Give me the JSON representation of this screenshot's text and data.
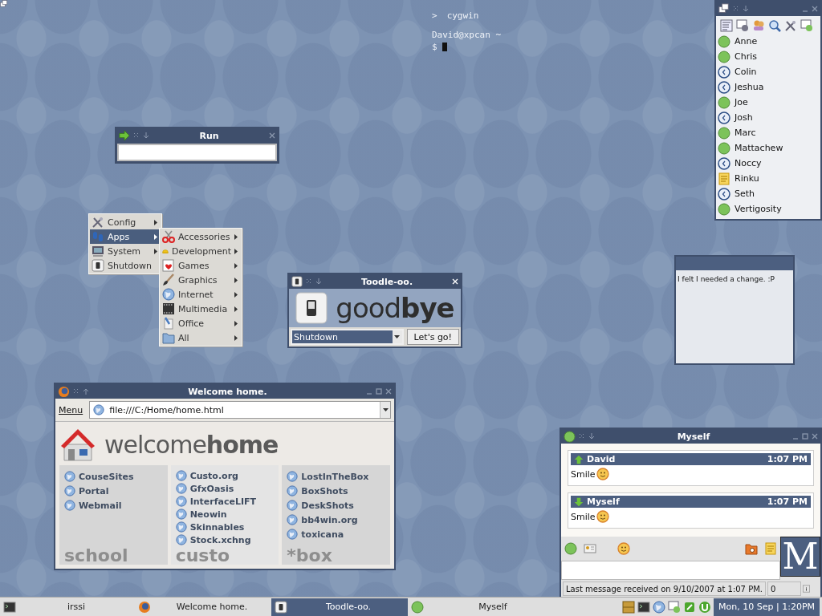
{
  "terminal": {
    "marker": ">",
    "title": "cygwin",
    "lines": [
      "David@xpcan ~",
      "$"
    ]
  },
  "run_window": {
    "title": "Run"
  },
  "start_menu": {
    "items": [
      {
        "label": "Config",
        "submenu": true,
        "selected": false
      },
      {
        "label": "Apps",
        "submenu": true,
        "selected": true
      },
      {
        "label": "System",
        "submenu": true,
        "selected": false
      },
      {
        "label": "Shutdown",
        "submenu": false,
        "selected": false
      }
    ],
    "submenu": {
      "items": [
        {
          "label": "Accessories",
          "submenu": true,
          "selected": false
        },
        {
          "label": "Development",
          "submenu": true,
          "selected": false
        },
        {
          "label": "Games",
          "submenu": true,
          "selected": false
        },
        {
          "label": "Graphics",
          "submenu": true,
          "selected": false
        },
        {
          "label": "Internet",
          "submenu": true,
          "selected": false
        },
        {
          "label": "Multimedia",
          "submenu": true,
          "selected": false
        },
        {
          "label": "Office",
          "submenu": true,
          "selected": false
        },
        {
          "label": "All",
          "submenu": true,
          "selected": false
        }
      ]
    }
  },
  "toodle_window": {
    "title": "Toodle-oo.",
    "logo": "good**bye**",
    "action": "Shutdown",
    "button": "Let's go!"
  },
  "note": {
    "text": "I felt I needed a change. :P"
  },
  "browser": {
    "title": "Welcome home.",
    "menu": "Menu",
    "url": "file:///C:/Home/home.html",
    "logo": "welcome**home**",
    "columns": [
      {
        "watermark": "school",
        "links": [
          "CouseSites",
          "Portal",
          "Webmail"
        ]
      },
      {
        "watermark": "custo",
        "links": [
          "Custo.org",
          "GfxOasis",
          "InterfaceLIFT",
          "Neowin",
          "Skinnables",
          "Stock.xchng"
        ]
      },
      {
        "watermark": "*box",
        "links": [
          "LostInTheBox",
          "BoxShots",
          "DeskShots",
          "bb4win.org",
          "toxicana"
        ]
      }
    ]
  },
  "buddy_list": {
    "buddies": [
      {
        "name": "Anne",
        "kind": "available"
      },
      {
        "name": "Chris",
        "kind": "available"
      },
      {
        "name": "Colin",
        "kind": "away"
      },
      {
        "name": "Jeshua",
        "kind": "away"
      },
      {
        "name": "Joe",
        "kind": "available"
      },
      {
        "name": "Josh",
        "kind": "away"
      },
      {
        "name": "Marc",
        "kind": "available"
      },
      {
        "name": "Mattachew",
        "kind": "available"
      },
      {
        "name": "Noccy",
        "kind": "away"
      },
      {
        "name": "Rinku",
        "kind": "note"
      },
      {
        "name": "Seth",
        "kind": "away"
      },
      {
        "name": "Vertigosity",
        "kind": "available"
      }
    ]
  },
  "chat": {
    "title": "Myself",
    "messages": [
      {
        "sender": "David",
        "kind": "incoming",
        "time": "1:07 PM",
        "text": "Smile"
      },
      {
        "sender": "Myself",
        "kind": "outgoing",
        "time": "1:07 PM",
        "text": "Smile"
      }
    ],
    "avatar_letter": "M",
    "status": "Last message received on 9/10/2007 at 1:07 PM.",
    "count": "0"
  },
  "taskbar": {
    "tasks": [
      {
        "label": "irssi",
        "selected": false
      },
      {
        "label": "Welcome home.",
        "selected": false
      },
      {
        "label": "Toodle-oo.",
        "selected": true
      },
      {
        "label": "Myself",
        "selected": false
      }
    ],
    "clock": "Mon, 10 Sep | 1:20PM"
  }
}
